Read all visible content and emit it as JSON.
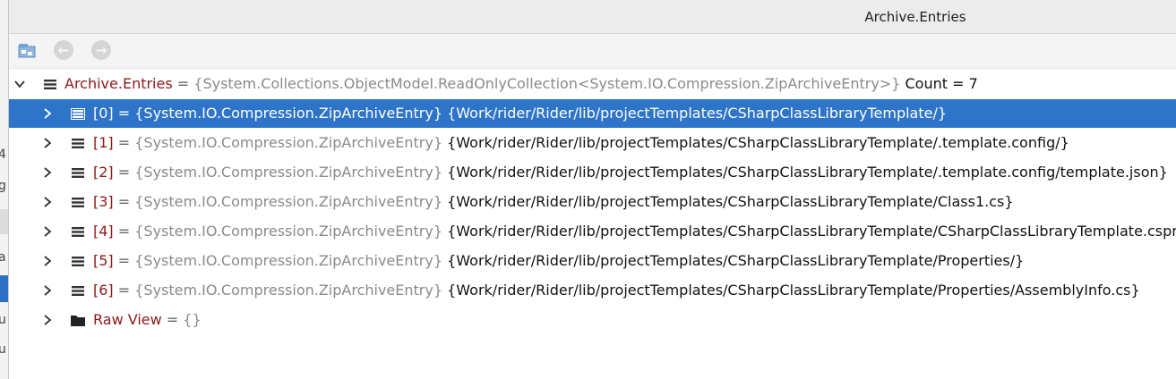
{
  "window": {
    "title": "Archive.Entries"
  },
  "left_fragments": [
    "4",
    "g",
    "a",
    "u",
    "u"
  ],
  "root": {
    "name": "Archive.Entries",
    "eq": " = ",
    "type": "{System.Collections.ObjectModel.ReadOnlyCollection<System.IO.Compression.ZipArchiveEntry>}",
    "value": " Count = 7"
  },
  "entries": [
    {
      "index": "[0]",
      "eq": " = ",
      "type": "{System.IO.Compression.ZipArchiveEntry}",
      "value": " {Work/rider/Rider/lib/projectTemplates/CSharpClassLibraryTemplate/}"
    },
    {
      "index": "[1]",
      "eq": " = ",
      "type": "{System.IO.Compression.ZipArchiveEntry}",
      "value": " {Work/rider/Rider/lib/projectTemplates/CSharpClassLibraryTemplate/.template.config/}"
    },
    {
      "index": "[2]",
      "eq": " = ",
      "type": "{System.IO.Compression.ZipArchiveEntry}",
      "value": " {Work/rider/Rider/lib/projectTemplates/CSharpClassLibraryTemplate/.template.config/template.json}"
    },
    {
      "index": "[3]",
      "eq": " = ",
      "type": "{System.IO.Compression.ZipArchiveEntry}",
      "value": " {Work/rider/Rider/lib/projectTemplates/CSharpClassLibraryTemplate/Class1.cs}"
    },
    {
      "index": "[4]",
      "eq": " = ",
      "type": "{System.IO.Compression.ZipArchiveEntry}",
      "value": " {Work/rider/Rider/lib/projectTemplates/CSharpClassLibraryTemplate/CSharpClassLibraryTemplate.csproj}"
    },
    {
      "index": "[5]",
      "eq": " = ",
      "type": "{System.IO.Compression.ZipArchiveEntry}",
      "value": " {Work/rider/Rider/lib/projectTemplates/CSharpClassLibraryTemplate/Properties/}"
    },
    {
      "index": "[6]",
      "eq": " = ",
      "type": "{System.IO.Compression.ZipArchiveEntry}",
      "value": " {Work/rider/Rider/lib/projectTemplates/CSharpClassLibraryTemplate/Properties/AssemblyInfo.cs}"
    }
  ],
  "raw_view": {
    "name": "Raw View",
    "eq": " = ",
    "value": "{}"
  },
  "icons": {
    "toolbar": [
      "folder-tree-icon",
      "back-icon",
      "forward-icon"
    ],
    "chevron_expanded": "chevron-down-icon",
    "chevron_collapsed": "chevron-right-icon",
    "field": "field-icon",
    "raw_view": "folder-icon"
  },
  "colors": {
    "selection": "#2e74c9",
    "name": "#8b1a1a",
    "type": "#8a8a8a",
    "value": "#111111"
  },
  "selected_index": 0
}
